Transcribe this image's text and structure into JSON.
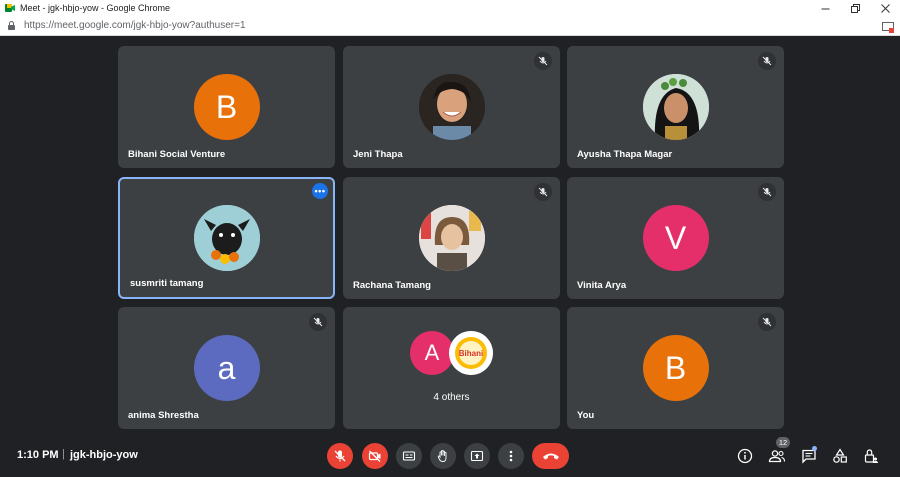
{
  "window": {
    "title": "Meet - jgk-hbjo-yow - Google Chrome",
    "url": "https://meet.google.com/jgk-hbjo-yow?authuser=1"
  },
  "tiles": [
    {
      "name": "Bihani Social Venture",
      "initial": "B",
      "color": "#e8710a",
      "muted": false
    },
    {
      "name": "Jeni Thapa",
      "initial": "",
      "color": "#202124",
      "muted": true
    },
    {
      "name": "Ayusha Thapa Magar",
      "initial": "",
      "color": "#cfe0d6",
      "muted": true
    },
    {
      "name": "susmriti tamang",
      "initial": "",
      "color": "#9fcfd6",
      "muted": false,
      "active": true
    },
    {
      "name": "Rachana Tamang",
      "initial": "",
      "color": "#e6e1dc",
      "muted": true
    },
    {
      "name": "Vinita Arya",
      "initial": "V",
      "color": "#e52f6b",
      "muted": true
    },
    {
      "name": "anima Shrestha",
      "initial": "a",
      "color": "#5c6bc0",
      "muted": true
    },
    {
      "name": "You",
      "initial": "B",
      "color": "#e8710a",
      "muted": true
    }
  ],
  "others": {
    "label": "4 others",
    "avatar1_initial": "A",
    "avatar1_color": "#e52f6b",
    "avatar2_logo_text": "Bihani"
  },
  "bottombar": {
    "time": "1:10 PM",
    "separator": "|",
    "meeting_code": "jgk-hbjo-yow",
    "participant_count": "12"
  },
  "colors": {
    "accent": "#1a73e8",
    "danger": "#ea4335",
    "tile_bg": "#3c4043",
    "page_bg": "#202124"
  }
}
